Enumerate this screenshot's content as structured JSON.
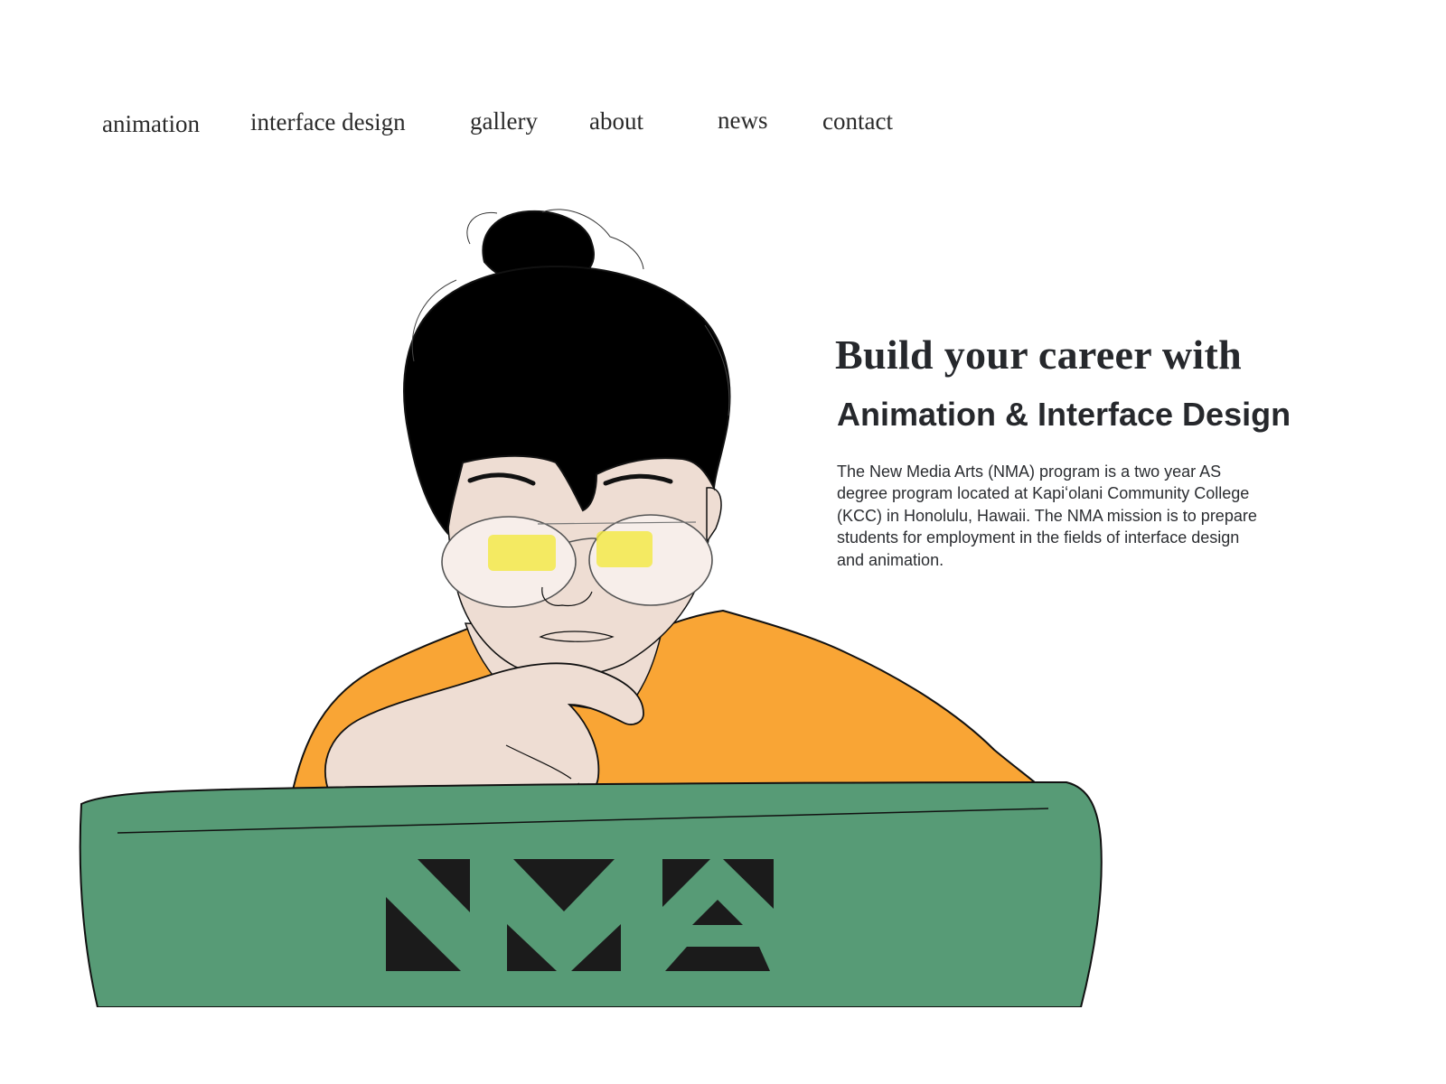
{
  "nav": {
    "items": [
      {
        "label": "animation"
      },
      {
        "label": "interface design"
      },
      {
        "label": "gallery"
      },
      {
        "label": "about"
      },
      {
        "label": "news"
      },
      {
        "label": "contact"
      }
    ]
  },
  "hero": {
    "title": "Build your career with",
    "subtitle": "Animation & Interface Design",
    "description": "The New Media Arts (NMA) program is a two year AS degree program located at Kapiʻolani Community College (KCC) in Honolulu, Hawaii. The NMA mission is to prepare students for employment in the fields of interface design and animation.",
    "illustration_icon": "student-at-laptop-illustration",
    "laptop_logo_icon": "nma-logo-icon"
  },
  "colors": {
    "text": "#26282c",
    "shirt": "#f9a535",
    "laptop": "#579b76",
    "skin": "#eeddd3",
    "hair": "#000000",
    "logo": "#1b1b1b",
    "glasses_glow": "#f2e840"
  }
}
